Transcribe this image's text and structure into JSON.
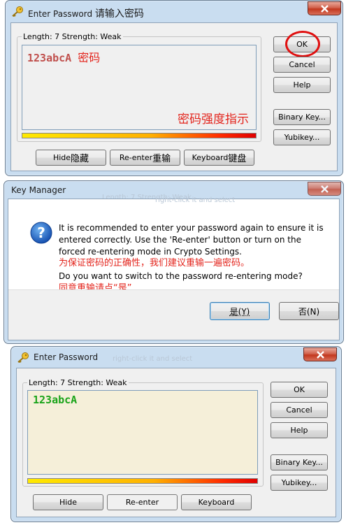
{
  "window1": {
    "title": "Enter Password",
    "title_annotation": "请输入密码",
    "legend": "Length: 7  Strength: Weak",
    "password_text": "123abcA",
    "password_annotation": "密码",
    "strength_annotation": "密码强度指示",
    "buttons": {
      "ok": "OK",
      "cancel": "Cancel",
      "help": "Help",
      "binary_key": "Binary Key...",
      "yubikey": "Yubikey...",
      "hide": "Hide",
      "hide_annotation": "隐藏",
      "reenter": "Re-enter",
      "reenter_annotation": "重输",
      "keyboard": "Keyboard",
      "keyboard_annotation": "键盘"
    }
  },
  "dialog": {
    "title": "Key Manager",
    "ghost_text_1": "Length: 7  Strength: Weak",
    "ghost_text_2": "right-click it and select",
    "message_line1": "It is recommended to enter your password again to ensure it is",
    "message_line2": "entered correctly. Use the 'Re-enter' button or turn on the",
    "message_line3": "forced re-entering mode in Crypto Settings.",
    "annotation1": "为保证密码的正确性，我们建议重输一遍密码。",
    "question": "Do you want to switch to the password re-entering mode?",
    "annotation2": "同意重输请点“是”",
    "yes_button": "是(Y)",
    "no_button": "否(N)"
  },
  "window2": {
    "title": "Enter Password",
    "ghost_text": "right-click it and select",
    "legend": "Length: 7  Strength: Weak",
    "password_text": "123abcA",
    "buttons": {
      "ok": "OK",
      "cancel": "Cancel",
      "help": "Help",
      "binary_key": "Binary Key...",
      "yubikey": "Yubikey...",
      "hide": "Hide",
      "reenter": "Re-enter",
      "keyboard": "Keyboard"
    }
  },
  "colors": {
    "annotation_red": "#e3241c",
    "password_text_1": "#c0504d",
    "password_text_2": "#1aa41a",
    "password_bg_2": "#f5efd9",
    "close_button_red": "#c2381f"
  }
}
